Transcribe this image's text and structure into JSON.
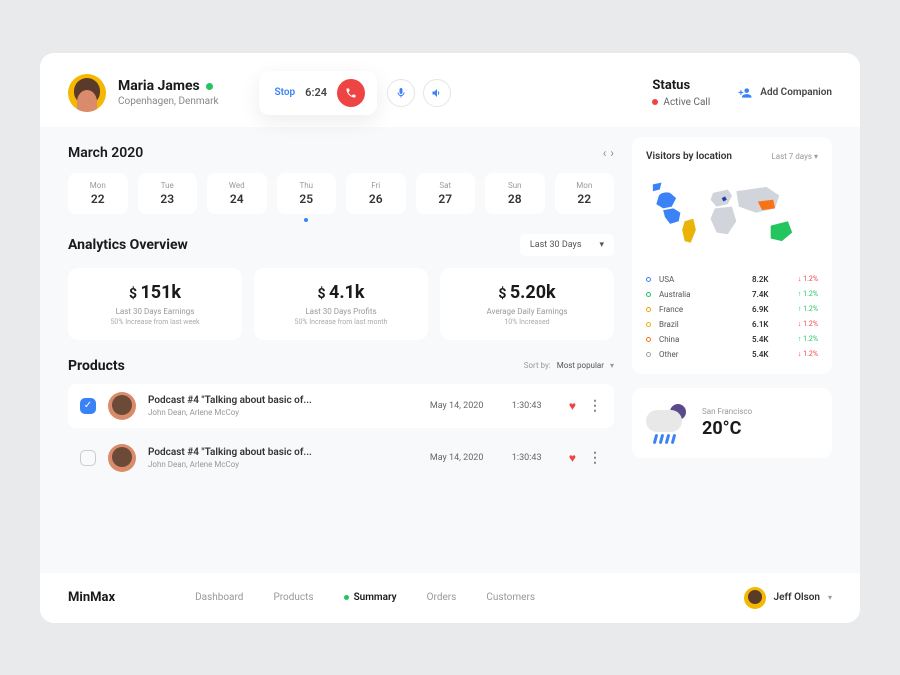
{
  "user": {
    "name": "Maria James",
    "location": "Copenhagen, Denmark"
  },
  "call": {
    "stop": "Stop",
    "timer": "6:24"
  },
  "status": {
    "title": "Status",
    "value": "Active Call"
  },
  "addCompanion": "Add Companion",
  "calendar": {
    "title": "March 2020",
    "days": [
      {
        "name": "Mon",
        "num": "22"
      },
      {
        "name": "Tue",
        "num": "23"
      },
      {
        "name": "Wed",
        "num": "24"
      },
      {
        "name": "Thu",
        "num": "25"
      },
      {
        "name": "Fri",
        "num": "26"
      },
      {
        "name": "Sat",
        "num": "27"
      },
      {
        "name": "Sun",
        "num": "28"
      },
      {
        "name": "Mon",
        "num": "22"
      }
    ]
  },
  "analytics": {
    "title": "Analytics Overview",
    "range": "Last 30 Days",
    "cards": [
      {
        "value": "151k",
        "label": "Last 30 Days Earnings",
        "sub": "50% Increase from last week"
      },
      {
        "value": "4.1k",
        "label": "Last 30 Days Profits",
        "sub": "50% Increase from last month"
      },
      {
        "value": "5.20k",
        "label": "Average Daily Earnings",
        "sub": "10% Increased"
      }
    ]
  },
  "products": {
    "title": "Products",
    "sortLabel": "Sort by:",
    "sortValue": "Most popular",
    "items": [
      {
        "checked": true,
        "title": "Podcast #4 \"Talking about basic of...",
        "sub": "John Dean, Arlene McCoy",
        "date": "May 14, 2020",
        "dur": "1:30:43"
      },
      {
        "checked": false,
        "title": "Podcast #4 \"Talking about basic of...",
        "sub": "John Dean, Arlene McCoy",
        "date": "May 14, 2020",
        "dur": "1:30:43"
      }
    ]
  },
  "visitors": {
    "title": "Visitors by location",
    "range": "Last 7 days",
    "items": [
      {
        "color": "#3b82f6",
        "name": "USA",
        "val": "8.2K",
        "chg": "1.2%",
        "dir": "down"
      },
      {
        "color": "#22c55e",
        "name": "Australia",
        "val": "7.4K",
        "chg": "1.2%",
        "dir": "up"
      },
      {
        "color": "#f59e0b",
        "name": "France",
        "val": "6.9K",
        "chg": "1.2%",
        "dir": "up"
      },
      {
        "color": "#eab308",
        "name": "Brazil",
        "val": "6.1K",
        "chg": "1.2%",
        "dir": "down"
      },
      {
        "color": "#f97316",
        "name": "China",
        "val": "5.4K",
        "chg": "1.2%",
        "dir": "up"
      },
      {
        "color": "#9ca3af",
        "name": "Other",
        "val": "5.4K",
        "chg": "1.2%",
        "dir": "down"
      }
    ]
  },
  "weather": {
    "city": "San Francisco",
    "temp": "20°C"
  },
  "footer": {
    "brand": "MinMax",
    "nav": [
      "Dashboard",
      "Products",
      "Summary",
      "Orders",
      "Customers"
    ],
    "user": "Jeff Olson"
  }
}
